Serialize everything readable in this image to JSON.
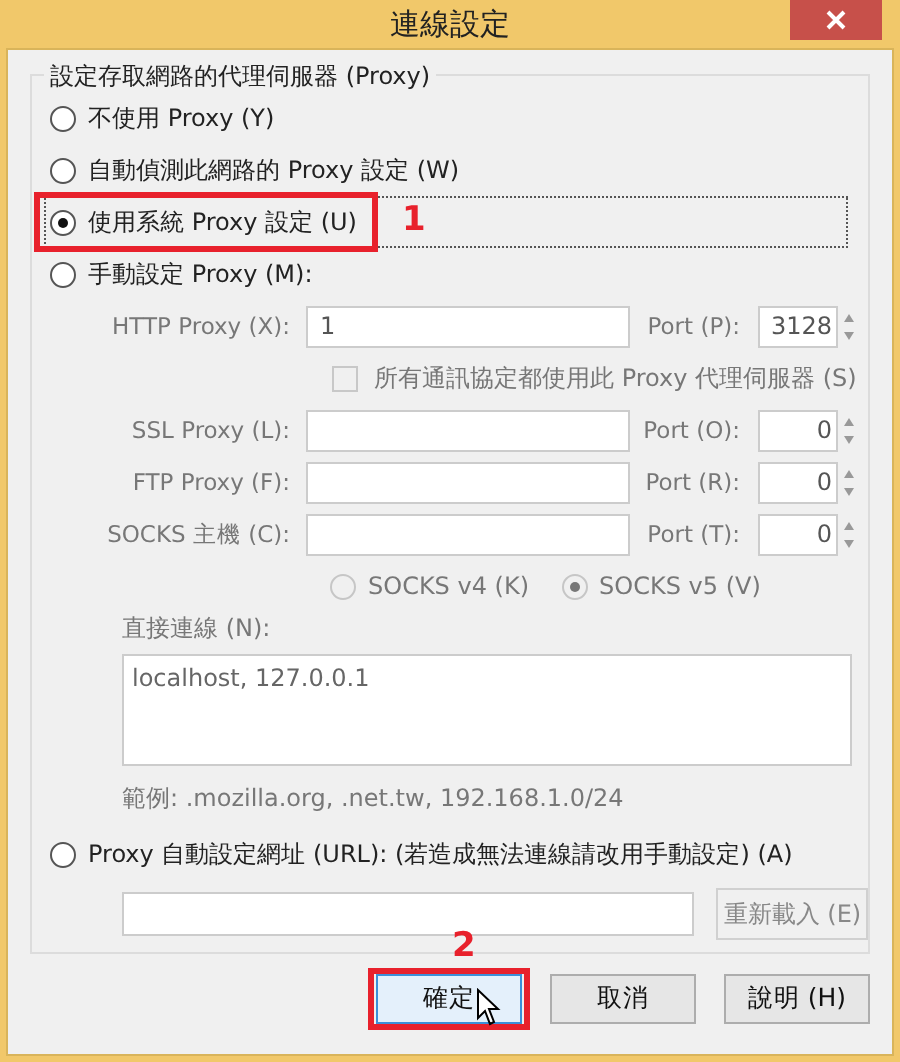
{
  "window": {
    "title": "連線設定"
  },
  "group": {
    "legend": "設定存取網路的代理伺服器 (Proxy)"
  },
  "modes": [
    {
      "label": "不使用 Proxy (Y)",
      "selected": false,
      "focused": false
    },
    {
      "label": "自動偵測此網路的 Proxy 設定 (W)",
      "selected": false,
      "focused": false
    },
    {
      "label": "使用系統 Proxy 設定 (U)",
      "selected": true,
      "focused": true,
      "annotation": "1"
    },
    {
      "label": "手動設定 Proxy (M):",
      "selected": false,
      "focused": false
    },
    {
      "label": "Proxy 自動設定網址 (URL): (若造成無法連線請改用手動設定) (A)",
      "selected": false,
      "focused": false
    }
  ],
  "manual": {
    "disabled": true,
    "proxies": [
      {
        "label": "HTTP Proxy (X):",
        "value": "1",
        "port_label": "Port (P):",
        "port": "3128"
      },
      {
        "label": "SSL Proxy (L):",
        "port_label": "Port (O):",
        "port": "0"
      },
      {
        "label": "FTP Proxy (F):",
        "port_label": "Port (R):",
        "port": "0"
      },
      {
        "label": "SOCKS 主機 (C):",
        "port_label": "Port (T):",
        "port": "0"
      }
    ],
    "share_all": {
      "label": "所有通訊協定都使用此 Proxy 代理伺服器 (S)",
      "checked": false
    },
    "socks_versions": [
      {
        "label": "SOCKS v4 (K)",
        "selected": false
      },
      {
        "label": "SOCKS v5 (V)",
        "selected": true
      }
    ],
    "no_proxy_label": "直接連線 (N):",
    "no_proxy": "localhost, 127.0.0.1",
    "example": "範例: .mozilla.org, .net.tw, 192.168.1.0/24"
  },
  "auto_url": {
    "disabled": true,
    "reload": "重新載入 (E)"
  },
  "buttons": [
    {
      "label": "確定",
      "default": true,
      "annotation": "2"
    },
    {
      "label": "取消",
      "default": false
    },
    {
      "label": "說明 (H)",
      "default": false
    }
  ]
}
